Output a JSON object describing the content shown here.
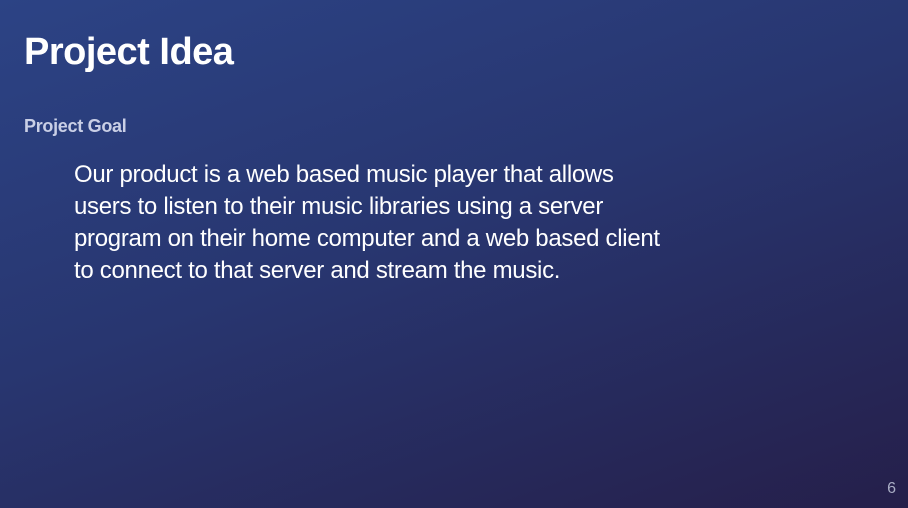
{
  "slide": {
    "title": "Project Idea",
    "section_label": "Project Goal",
    "body_lines": [
      "Our product is a web based music player that allows",
      "users to listen to their music libraries using a server",
      "program on their home computer and a web based client",
      "to connect to that server and stream the music."
    ],
    "page_number": "6"
  },
  "colors": {
    "background_top": "#2c4385",
    "background_bottom": "#251f4a",
    "title": "#ffffff",
    "section_label": "#c9cfe6",
    "body_text": "#ffffff",
    "page_number": "#a9adc4"
  }
}
